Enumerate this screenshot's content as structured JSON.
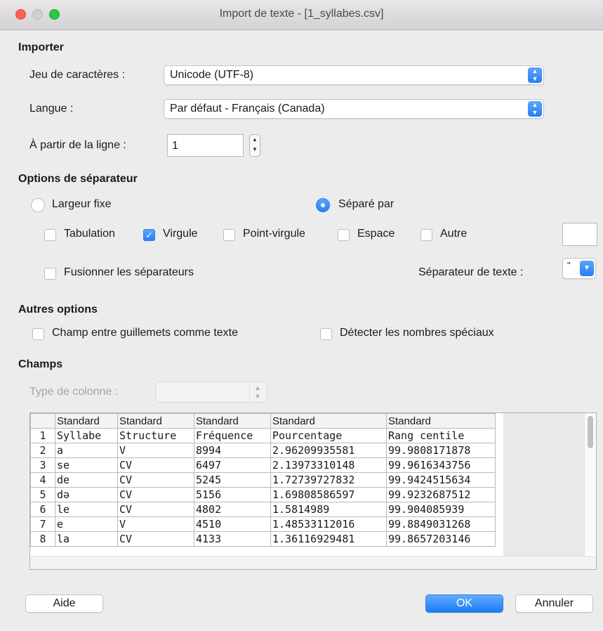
{
  "window": {
    "title": "Import de texte - [1_syllabes.csv]"
  },
  "importer": {
    "section": "Importer",
    "charset_label": "Jeu de caractères :",
    "charset_value": "Unicode (UTF-8)",
    "language_label": "Langue :",
    "language_value": "Par défaut - Français (Canada)",
    "from_row_label": "À partir de la ligne :",
    "from_row_value": "1"
  },
  "separator": {
    "section": "Options de séparateur",
    "fixed_width": "Largeur fixe",
    "separated_by": "Séparé par",
    "tab": "Tabulation",
    "comma": "Virgule",
    "semicolon": "Point-virgule",
    "space": "Espace",
    "other": "Autre",
    "merge": "Fusionner les séparateurs",
    "text_delim_label": "Séparateur de texte :",
    "text_delim_value": "\""
  },
  "other_options": {
    "section": "Autres options",
    "quoted_as_text": "Champ entre guillemets comme texte",
    "detect_special": "Détecter les nombres spéciaux"
  },
  "fields": {
    "section": "Champs",
    "column_type_label": "Type de colonne :",
    "header": [
      "Standard",
      "Standard",
      "Standard",
      "Standard",
      "Standard"
    ],
    "rows": [
      [
        "1",
        "Syllabe",
        "Structure",
        "Fréquence",
        "Pourcentage",
        "Rang centile"
      ],
      [
        "2",
        "a",
        "V",
        "8994",
        "2.96209935581",
        "99.9808171878"
      ],
      [
        "3",
        "se",
        "CV",
        "6497",
        "2.13973310148",
        "99.9616343756"
      ],
      [
        "4",
        "de",
        "CV",
        "5245",
        "1.72739727832",
        "99.9424515634"
      ],
      [
        "5",
        "də",
        "CV",
        "5156",
        "1.69808586597",
        "99.9232687512"
      ],
      [
        "6",
        "le",
        "CV",
        "4802",
        "1.5814989",
        "99.904085939"
      ],
      [
        "7",
        "e",
        "V",
        "4510",
        "1.48533112016",
        "99.8849031268"
      ],
      [
        "8",
        "la",
        "CV",
        "4133",
        "1.36116929481",
        "99.8657203146"
      ]
    ]
  },
  "buttons": {
    "help": "Aide",
    "ok": "OK",
    "cancel": "Annuler"
  },
  "colors": {
    "accent": "#2a7ef2",
    "close": "#fc5f57",
    "maximize": "#2bc840"
  }
}
